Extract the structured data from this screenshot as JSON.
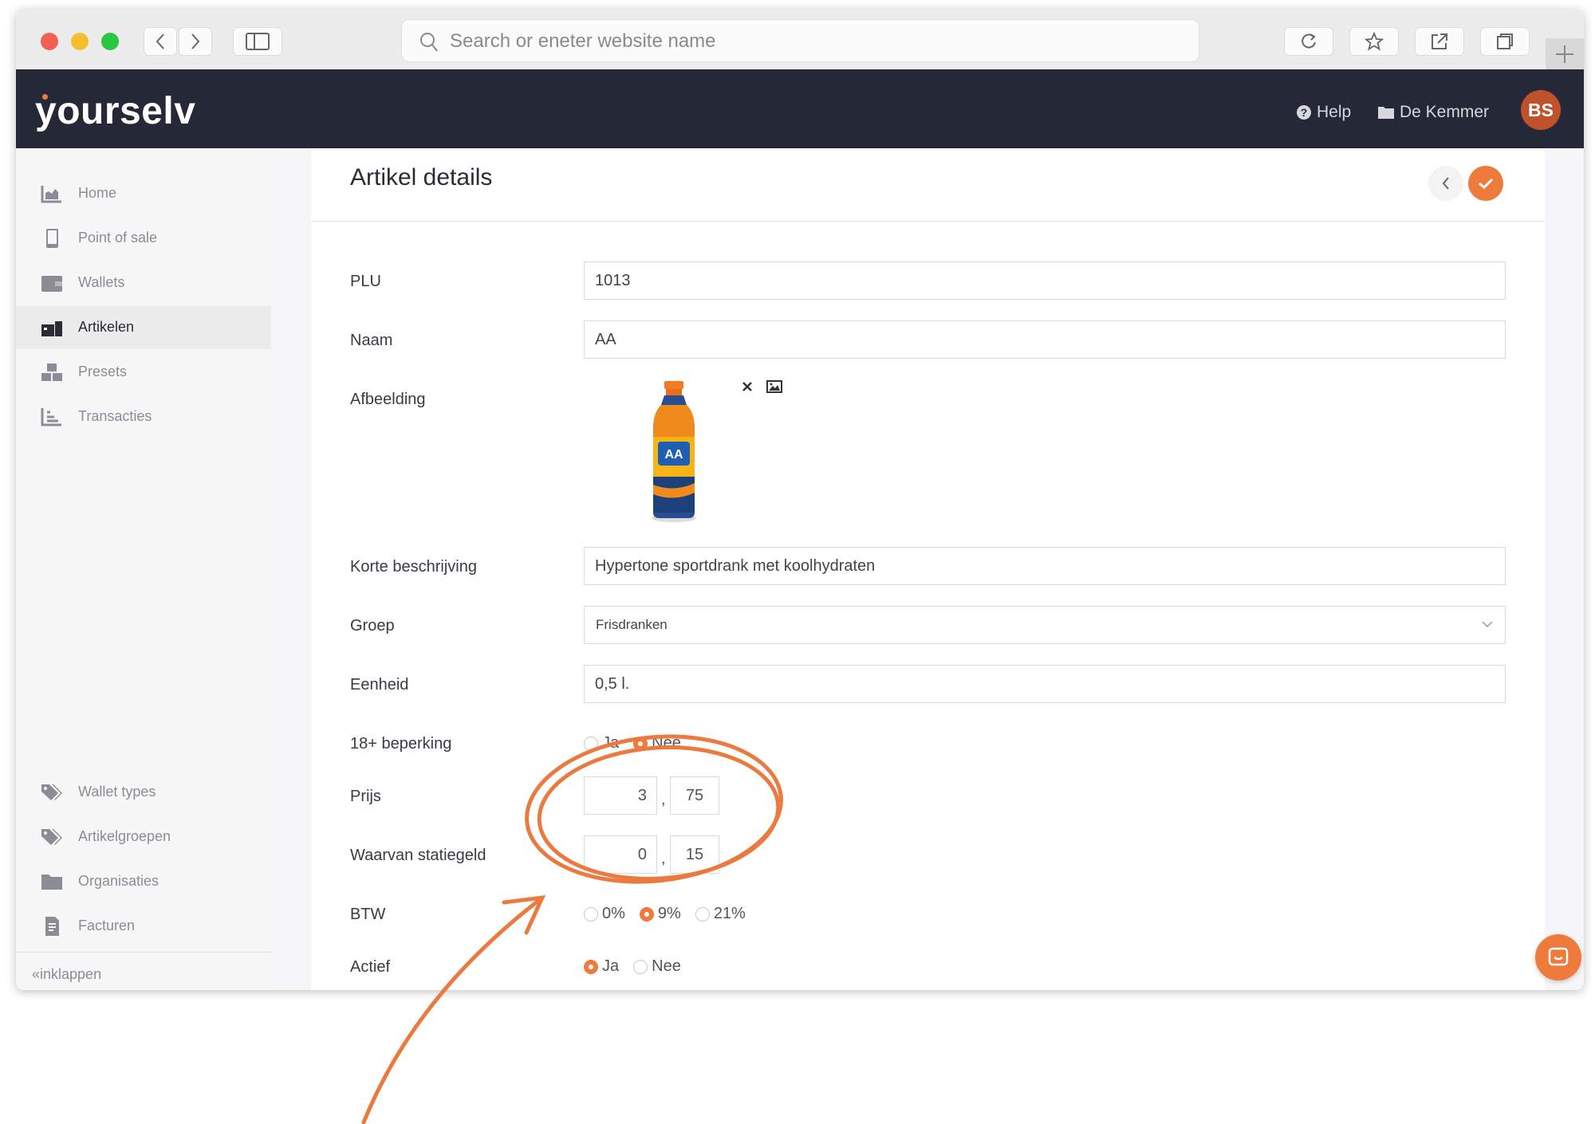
{
  "browser": {
    "url_placeholder": "Search or eneter website name"
  },
  "app": {
    "logo": "yourselv",
    "help_label": "Help",
    "org_label": "De Kemmer",
    "avatar_initials": "BS",
    "accent_color": "#ee7a3c",
    "header_color": "#252836"
  },
  "sidebar": {
    "items": [
      {
        "label": "Home",
        "icon": "chart-icon"
      },
      {
        "label": "Point of sale",
        "icon": "tablet-icon"
      },
      {
        "label": "Wallets",
        "icon": "wallet-icon"
      },
      {
        "label": "Artikelen",
        "icon": "articles-icon",
        "active": true
      },
      {
        "label": "Presets",
        "icon": "boxes-icon"
      },
      {
        "label": "Transacties",
        "icon": "stairs-chart-icon"
      }
    ],
    "bottom_items": [
      {
        "label": "Wallet types",
        "icon": "tags-icon"
      },
      {
        "label": "Artikelgroepen",
        "icon": "tags-icon"
      },
      {
        "label": "Organisaties",
        "icon": "folder-icon"
      },
      {
        "label": "Facturen",
        "icon": "invoice-icon"
      }
    ],
    "collapse_label": "inklappen"
  },
  "page": {
    "title": "Artikel details"
  },
  "form": {
    "plu_label": "PLU",
    "plu_value": "1013",
    "naam_label": "Naam",
    "naam_value": "AA",
    "afbeelding_label": "Afbeelding",
    "korte_label": "Korte beschrijving",
    "korte_value": "Hypertone sportdrank met koolhydraten",
    "groep_label": "Groep",
    "groep_value": "Frisdranken",
    "eenheid_label": "Eenheid",
    "eenheid_value": "0,5 l.",
    "leeftijd_label": "18+ beperking",
    "leeftijd_options": [
      "Ja",
      "Nee"
    ],
    "leeftijd_selected": "Nee",
    "prijs_label": "Prijs",
    "prijs_whole": "3",
    "prijs_cents": "75",
    "statiegeld_label": "Waarvan statiegeld",
    "statiegeld_whole": "0",
    "statiegeld_cents": "15",
    "btw_label": "BTW",
    "btw_options": [
      "0%",
      "9%",
      "21%"
    ],
    "btw_selected": "9%",
    "actief_label": "Actief",
    "actief_options": [
      "Ja",
      "Nee"
    ],
    "actief_selected": "Ja",
    "comma": ","
  }
}
